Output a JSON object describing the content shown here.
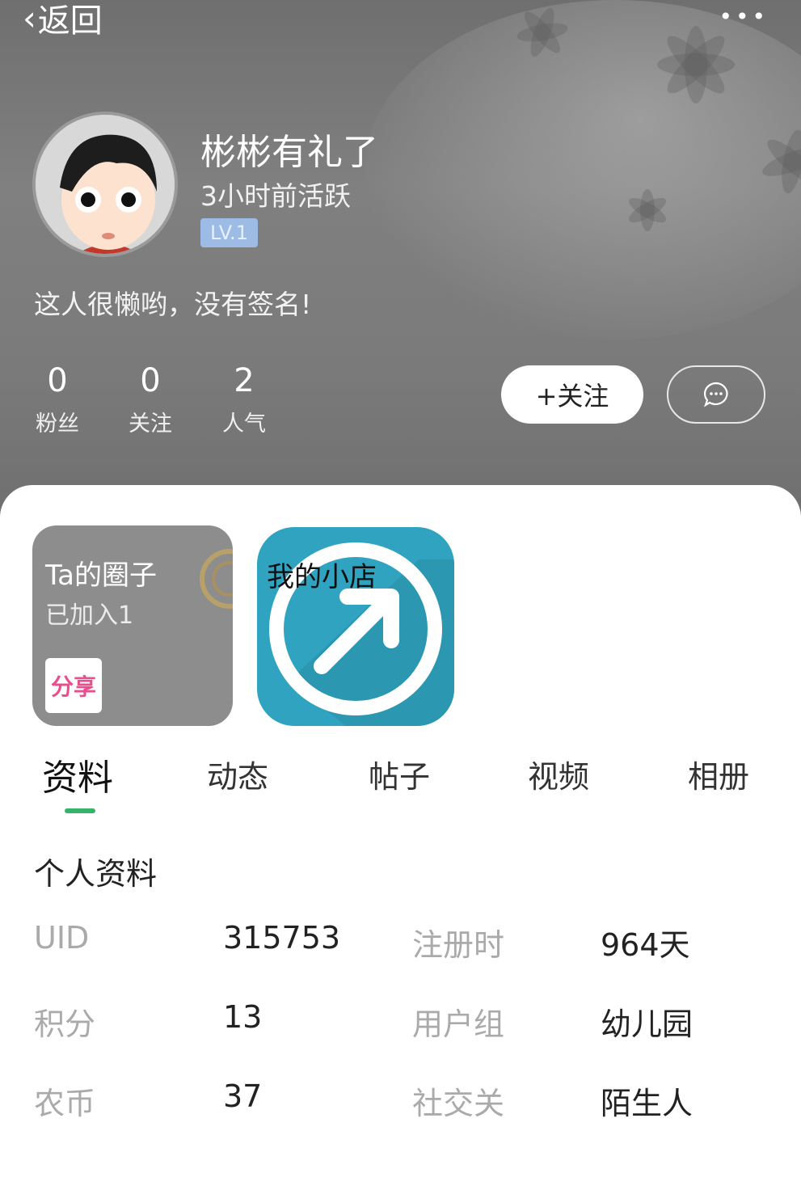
{
  "nav": {
    "back_label": "返回",
    "more_label": "•••"
  },
  "profile": {
    "username": "彬彬有礼了",
    "active_time": "3小时前活跃",
    "level": "LV.1",
    "signature": "这人很懒哟，没有签名!"
  },
  "stats": [
    {
      "value": "0",
      "label": "粉丝"
    },
    {
      "value": "0",
      "label": "关注"
    },
    {
      "value": "2",
      "label": "人气"
    }
  ],
  "actions": {
    "follow_label": "+关注",
    "message_icon": "chat-bubble-icon"
  },
  "cards": {
    "circle": {
      "title": "Ta的圈子",
      "subtitle": "已加入1",
      "share_label": "分享"
    },
    "shop": {
      "title": "我的小店"
    }
  },
  "tabs": [
    {
      "label": "资料",
      "active": true
    },
    {
      "label": "动态"
    },
    {
      "label": "帖子"
    },
    {
      "label": "视频"
    },
    {
      "label": "相册"
    }
  ],
  "profile_details": {
    "section_title": "个人资料",
    "rows": [
      {
        "left_key": "UID",
        "left_value": "315753",
        "right_key": "注册时",
        "right_value": "964天"
      },
      {
        "left_key": "积分",
        "left_value": "13",
        "right_key": "用户组",
        "right_value": "幼儿园"
      },
      {
        "left_key": "农币",
        "left_value": "37",
        "right_key": "社交关",
        "right_value": "陌生人"
      }
    ]
  },
  "colors": {
    "header_bg": "#7a7a7a",
    "level_badge": "#9cbce6",
    "active_tab_underline": "#35b36a",
    "shop_card": "#2fa3bf",
    "circle_card": "#8d8d8d"
  }
}
